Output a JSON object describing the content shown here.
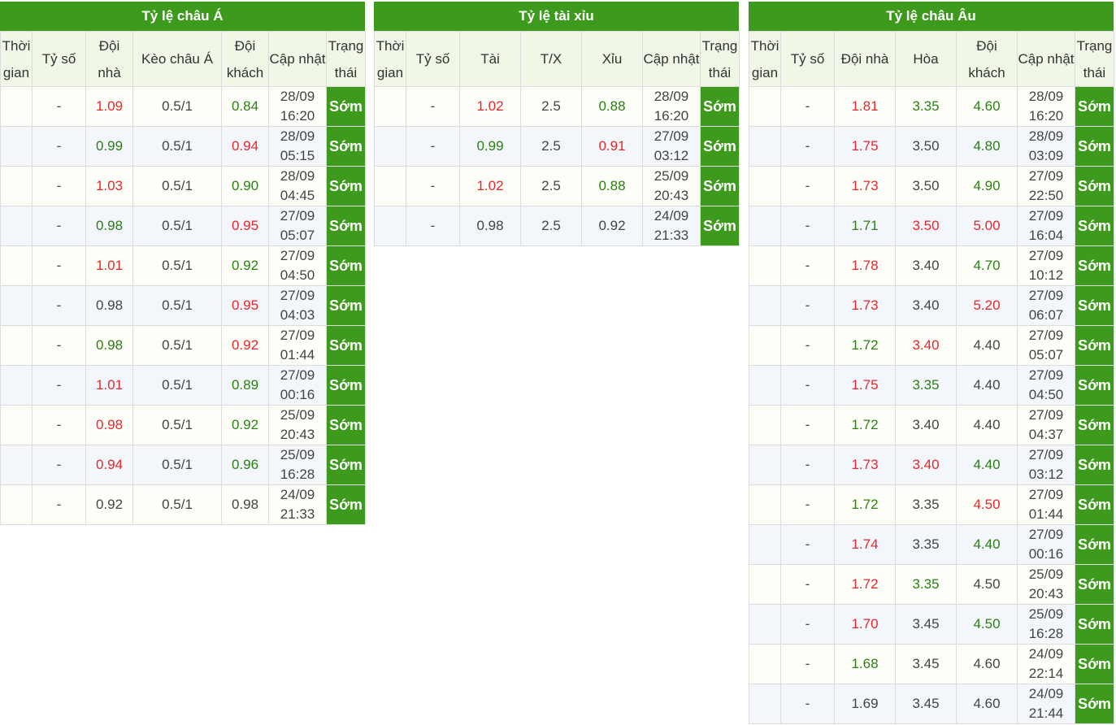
{
  "asian": {
    "title": "Tỷ lệ châu Á",
    "headers": [
      "Thời gian",
      "Tỷ số",
      "Đội nhà",
      "Kèo châu Á",
      "Đội khách",
      "Cập nhật",
      "Trạng thái"
    ],
    "rows": [
      {
        "time": "",
        "score": "-",
        "home": "1.09",
        "home_color": "red",
        "line": "0.5/1",
        "away": "0.84",
        "away_color": "green",
        "updated_date": "28/09",
        "updated_time": "16:20",
        "status": "Sớm"
      },
      {
        "time": "",
        "score": "-",
        "home": "0.99",
        "home_color": "green",
        "line": "0.5/1",
        "away": "0.94",
        "away_color": "red",
        "updated_date": "28/09",
        "updated_time": "05:15",
        "status": "Sớm"
      },
      {
        "time": "",
        "score": "-",
        "home": "1.03",
        "home_color": "red",
        "line": "0.5/1",
        "away": "0.90",
        "away_color": "green",
        "updated_date": "28/09",
        "updated_time": "04:45",
        "status": "Sớm"
      },
      {
        "time": "",
        "score": "-",
        "home": "0.98",
        "home_color": "green",
        "line": "0.5/1",
        "away": "0.95",
        "away_color": "red",
        "updated_date": "27/09",
        "updated_time": "05:07",
        "status": "Sớm"
      },
      {
        "time": "",
        "score": "-",
        "home": "1.01",
        "home_color": "red",
        "line": "0.5/1",
        "away": "0.92",
        "away_color": "green",
        "updated_date": "27/09",
        "updated_time": "04:50",
        "status": "Sớm"
      },
      {
        "time": "",
        "score": "-",
        "home": "0.98",
        "home_color": "",
        "line": "0.5/1",
        "away": "0.95",
        "away_color": "red",
        "updated_date": "27/09",
        "updated_time": "04:03",
        "status": "Sớm"
      },
      {
        "time": "",
        "score": "-",
        "home": "0.98",
        "home_color": "green",
        "line": "0.5/1",
        "away": "0.92",
        "away_color": "red",
        "updated_date": "27/09",
        "updated_time": "01:44",
        "status": "Sớm"
      },
      {
        "time": "",
        "score": "-",
        "home": "1.01",
        "home_color": "red",
        "line": "0.5/1",
        "away": "0.89",
        "away_color": "green",
        "updated_date": "27/09",
        "updated_time": "00:16",
        "status": "Sớm"
      },
      {
        "time": "",
        "score": "-",
        "home": "0.98",
        "home_color": "red",
        "line": "0.5/1",
        "away": "0.92",
        "away_color": "green",
        "updated_date": "25/09",
        "updated_time": "20:43",
        "status": "Sớm"
      },
      {
        "time": "",
        "score": "-",
        "home": "0.94",
        "home_color": "red",
        "line": "0.5/1",
        "away": "0.96",
        "away_color": "green",
        "updated_date": "25/09",
        "updated_time": "16:28",
        "status": "Sớm"
      },
      {
        "time": "",
        "score": "-",
        "home": "0.92",
        "home_color": "",
        "line": "0.5/1",
        "away": "0.98",
        "away_color": "",
        "updated_date": "24/09",
        "updated_time": "21:33",
        "status": "Sớm"
      }
    ]
  },
  "overunder": {
    "title": "Tỷ lệ tài xỉu",
    "headers": [
      "Thời gian",
      "Tỷ số",
      "Tài",
      "T/X",
      "Xỉu",
      "Cập nhật",
      "Trạng thái"
    ],
    "rows": [
      {
        "time": "",
        "score": "-",
        "over": "1.02",
        "over_color": "red",
        "line": "2.5",
        "under": "0.88",
        "under_color": "green",
        "updated_date": "28/09",
        "updated_time": "16:20",
        "status": "Sớm"
      },
      {
        "time": "",
        "score": "-",
        "over": "0.99",
        "over_color": "green",
        "line": "2.5",
        "under": "0.91",
        "under_color": "red",
        "updated_date": "27/09",
        "updated_time": "03:12",
        "status": "Sớm"
      },
      {
        "time": "",
        "score": "-",
        "over": "1.02",
        "over_color": "red",
        "line": "2.5",
        "under": "0.88",
        "under_color": "green",
        "updated_date": "25/09",
        "updated_time": "20:43",
        "status": "Sớm"
      },
      {
        "time": "",
        "score": "-",
        "over": "0.98",
        "over_color": "",
        "line": "2.5",
        "under": "0.92",
        "under_color": "",
        "updated_date": "24/09",
        "updated_time": "21:33",
        "status": "Sớm"
      }
    ]
  },
  "european": {
    "title": "Tỷ lệ châu Âu",
    "headers": [
      "Thời gian",
      "Tỷ số",
      "Đội nhà",
      "Hòa",
      "Đội khách",
      "Cập nhật",
      "Trạng thái"
    ],
    "rows": [
      {
        "time": "",
        "score": "-",
        "home": "1.81",
        "home_color": "red",
        "draw": "3.35",
        "draw_color": "green",
        "away": "4.60",
        "away_color": "green",
        "updated_date": "28/09",
        "updated_time": "16:20",
        "status": "Sớm"
      },
      {
        "time": "",
        "score": "-",
        "home": "1.75",
        "home_color": "red",
        "draw": "3.50",
        "draw_color": "",
        "away": "4.80",
        "away_color": "green",
        "updated_date": "28/09",
        "updated_time": "03:09",
        "status": "Sớm"
      },
      {
        "time": "",
        "score": "-",
        "home": "1.73",
        "home_color": "red",
        "draw": "3.50",
        "draw_color": "",
        "away": "4.90",
        "away_color": "green",
        "updated_date": "27/09",
        "updated_time": "22:50",
        "status": "Sớm"
      },
      {
        "time": "",
        "score": "-",
        "home": "1.71",
        "home_color": "green",
        "draw": "3.50",
        "draw_color": "red",
        "away": "5.00",
        "away_color": "red",
        "updated_date": "27/09",
        "updated_time": "16:04",
        "status": "Sớm"
      },
      {
        "time": "",
        "score": "-",
        "home": "1.78",
        "home_color": "red",
        "draw": "3.40",
        "draw_color": "",
        "away": "4.70",
        "away_color": "green",
        "updated_date": "27/09",
        "updated_time": "10:12",
        "status": "Sớm"
      },
      {
        "time": "",
        "score": "-",
        "home": "1.73",
        "home_color": "red",
        "draw": "3.40",
        "draw_color": "",
        "away": "5.20",
        "away_color": "red",
        "updated_date": "27/09",
        "updated_time": "06:07",
        "status": "Sớm"
      },
      {
        "time": "",
        "score": "-",
        "home": "1.72",
        "home_color": "green",
        "draw": "3.40",
        "draw_color": "red",
        "away": "4.40",
        "away_color": "",
        "updated_date": "27/09",
        "updated_time": "05:07",
        "status": "Sớm"
      },
      {
        "time": "",
        "score": "-",
        "home": "1.75",
        "home_color": "red",
        "draw": "3.35",
        "draw_color": "green",
        "away": "4.40",
        "away_color": "",
        "updated_date": "27/09",
        "updated_time": "04:50",
        "status": "Sớm"
      },
      {
        "time": "",
        "score": "-",
        "home": "1.72",
        "home_color": "green",
        "draw": "3.40",
        "draw_color": "",
        "away": "4.40",
        "away_color": "",
        "updated_date": "27/09",
        "updated_time": "04:37",
        "status": "Sớm"
      },
      {
        "time": "",
        "score": "-",
        "home": "1.73",
        "home_color": "red",
        "draw": "3.40",
        "draw_color": "red",
        "away": "4.40",
        "away_color": "green",
        "updated_date": "27/09",
        "updated_time": "03:12",
        "status": "Sớm"
      },
      {
        "time": "",
        "score": "-",
        "home": "1.72",
        "home_color": "green",
        "draw": "3.35",
        "draw_color": "",
        "away": "4.50",
        "away_color": "red",
        "updated_date": "27/09",
        "updated_time": "01:44",
        "status": "Sớm"
      },
      {
        "time": "",
        "score": "-",
        "home": "1.74",
        "home_color": "red",
        "draw": "3.35",
        "draw_color": "",
        "away": "4.40",
        "away_color": "green",
        "updated_date": "27/09",
        "updated_time": "00:16",
        "status": "Sớm"
      },
      {
        "time": "",
        "score": "-",
        "home": "1.72",
        "home_color": "red",
        "draw": "3.35",
        "draw_color": "green",
        "away": "4.50",
        "away_color": "",
        "updated_date": "25/09",
        "updated_time": "20:43",
        "status": "Sớm"
      },
      {
        "time": "",
        "score": "-",
        "home": "1.70",
        "home_color": "red",
        "draw": "3.45",
        "draw_color": "",
        "away": "4.50",
        "away_color": "green",
        "updated_date": "25/09",
        "updated_time": "16:28",
        "status": "Sớm"
      },
      {
        "time": "",
        "score": "-",
        "home": "1.68",
        "home_color": "green",
        "draw": "3.45",
        "draw_color": "",
        "away": "4.60",
        "away_color": "",
        "updated_date": "24/09",
        "updated_time": "22:14",
        "status": "Sớm"
      },
      {
        "time": "",
        "score": "-",
        "home": "1.69",
        "home_color": "",
        "draw": "3.45",
        "draw_color": "",
        "away": "4.60",
        "away_color": "",
        "updated_date": "24/09",
        "updated_time": "21:44",
        "status": "Sớm"
      }
    ]
  }
}
